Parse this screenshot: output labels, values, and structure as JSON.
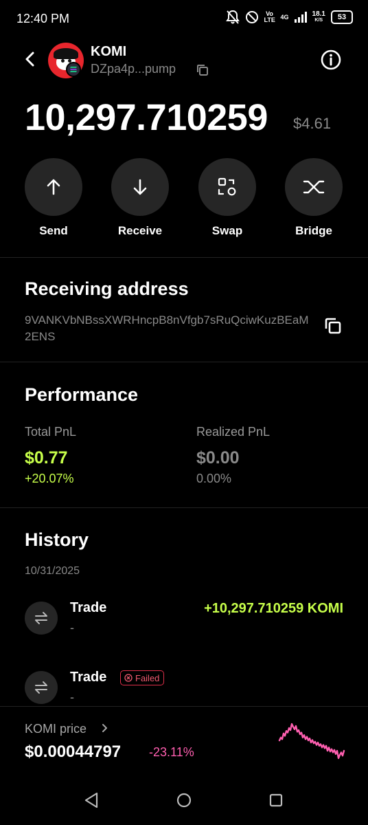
{
  "status_bar": {
    "time": "12:40 PM",
    "net_type": "Vo LTE",
    "net_gen": "4G",
    "speed_value": "18.1",
    "speed_unit": "K/S",
    "battery": "53"
  },
  "header": {
    "token_name": "KOMI",
    "token_address": "DZpa4p...pump"
  },
  "balance": {
    "amount": "10,297.710259",
    "usd_value": "$4.61"
  },
  "actions": {
    "send": "Send",
    "receive": "Receive",
    "swap": "Swap",
    "bridge": "Bridge"
  },
  "receiving": {
    "title": "Receiving address",
    "address": "9VANKVbNBssXWRHncpB8nVfgb7sRuQciwKuzBEaM2ENS"
  },
  "performance": {
    "title": "Performance",
    "total_label": "Total PnL",
    "total_value": "$0.77",
    "total_pct": "+20.07%",
    "realized_label": "Realized PnL",
    "realized_value": "$0.00",
    "realized_pct": "0.00%"
  },
  "history": {
    "title": "History",
    "date": "10/31/2025",
    "items": [
      {
        "title": "Trade",
        "sub": "-",
        "amount": "+10,297.710259 KOMI"
      },
      {
        "title": "Trade",
        "sub": "-",
        "badge": "Failed"
      }
    ]
  },
  "price": {
    "label": "KOMI price",
    "value": "$0.00044797",
    "change": "-23.11%"
  },
  "sparkline_data": [
    0.55,
    0.62,
    0.58,
    0.72,
    0.66,
    0.78,
    0.74,
    0.85,
    0.8,
    0.95,
    0.88,
    0.82,
    0.9,
    0.76,
    0.8,
    0.7,
    0.74,
    0.62,
    0.68,
    0.58,
    0.64,
    0.55,
    0.6,
    0.5,
    0.56,
    0.48,
    0.52,
    0.44,
    0.5,
    0.42,
    0.46,
    0.38,
    0.44,
    0.36,
    0.42,
    0.3,
    0.38,
    0.28,
    0.34,
    0.26,
    0.32,
    0.22,
    0.3,
    0.12,
    0.2,
    0.26,
    0.18,
    0.3
  ],
  "colors": {
    "positive": "#c7ff4a",
    "negative": "#ff5fb0",
    "muted": "#8a8a8a",
    "button_bg": "#262626"
  }
}
